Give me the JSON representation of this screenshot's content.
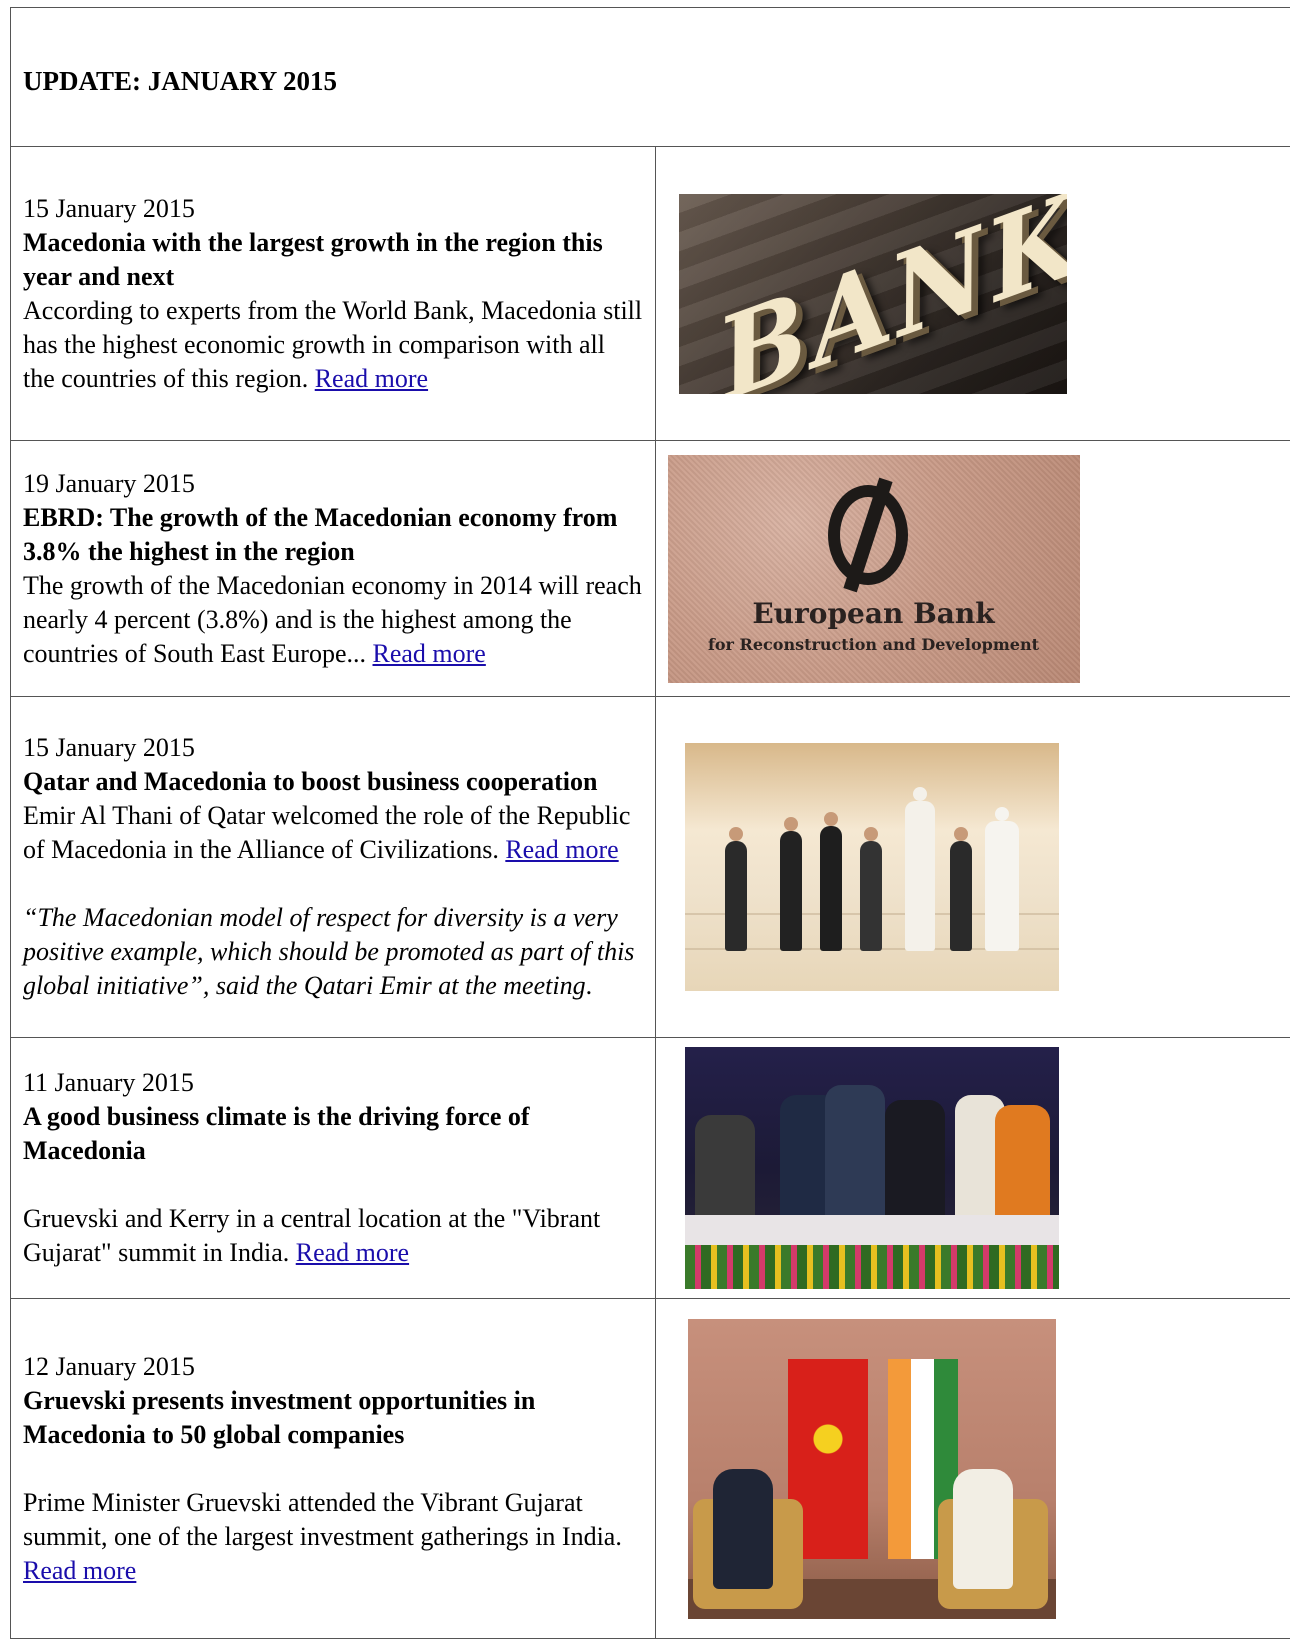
{
  "header": {
    "title": "UPDATE: JANUARY 2015"
  },
  "read_more_label": "Read more",
  "articles": [
    {
      "date": "15 January 2015",
      "title": "Macedonia with the largest growth in the region this year and next",
      "body": "According to experts from the World Bank, Macedonia still has the highest economic growth in comparison with all the countries of this region.",
      "image": "bank-sign-photo",
      "image_text": "BANK"
    },
    {
      "date": "19 January 2015",
      "title": "EBRD: The growth of the Macedonian economy from 3.8% the highest in the region",
      "body": "The growth of the Macedonian economy in 2014 will reach nearly 4 percent (3.8%) and is the highest among the countries of South East Europe...",
      "image": "ebrd-logo-wall-photo",
      "image_text": "European Bank",
      "image_subtext": "for Reconstruction and Development"
    },
    {
      "date": "15 January 2015",
      "title": "Qatar and Macedonia to boost business cooperation",
      "body": "Emir Al Thani of Qatar welcomed the role of the Republic of Macedonia in the Alliance of Civilizations.",
      "quote_prefix": "“The Macedonian model of respect for diversity is a very positive example, which should be promoted as part of this global initiative”, said the Qatari Emir at the meeting",
      "quote_suffix": ".",
      "image": "delegation-walking-photo"
    },
    {
      "date": "11 January 2015",
      "title": "A good business climate is the driving force of Macedonia",
      "body": "Gruevski and Kerry in a central location at the \"Vibrant Gujarat\" summit in India.",
      "image": "summit-handshake-photo"
    },
    {
      "date": "12 January 2015",
      "title": "Gruevski presents investment opportunities in Macedonia to 50 global companies",
      "body": "Prime Minister Gruevski attended the Vibrant Gujarat summit, one of the largest investment gatherings in India.",
      "image": "bilateral-meeting-flags-photo"
    }
  ],
  "colors": {
    "link": "#1a0dab",
    "border": "#555555",
    "text": "#000000"
  }
}
